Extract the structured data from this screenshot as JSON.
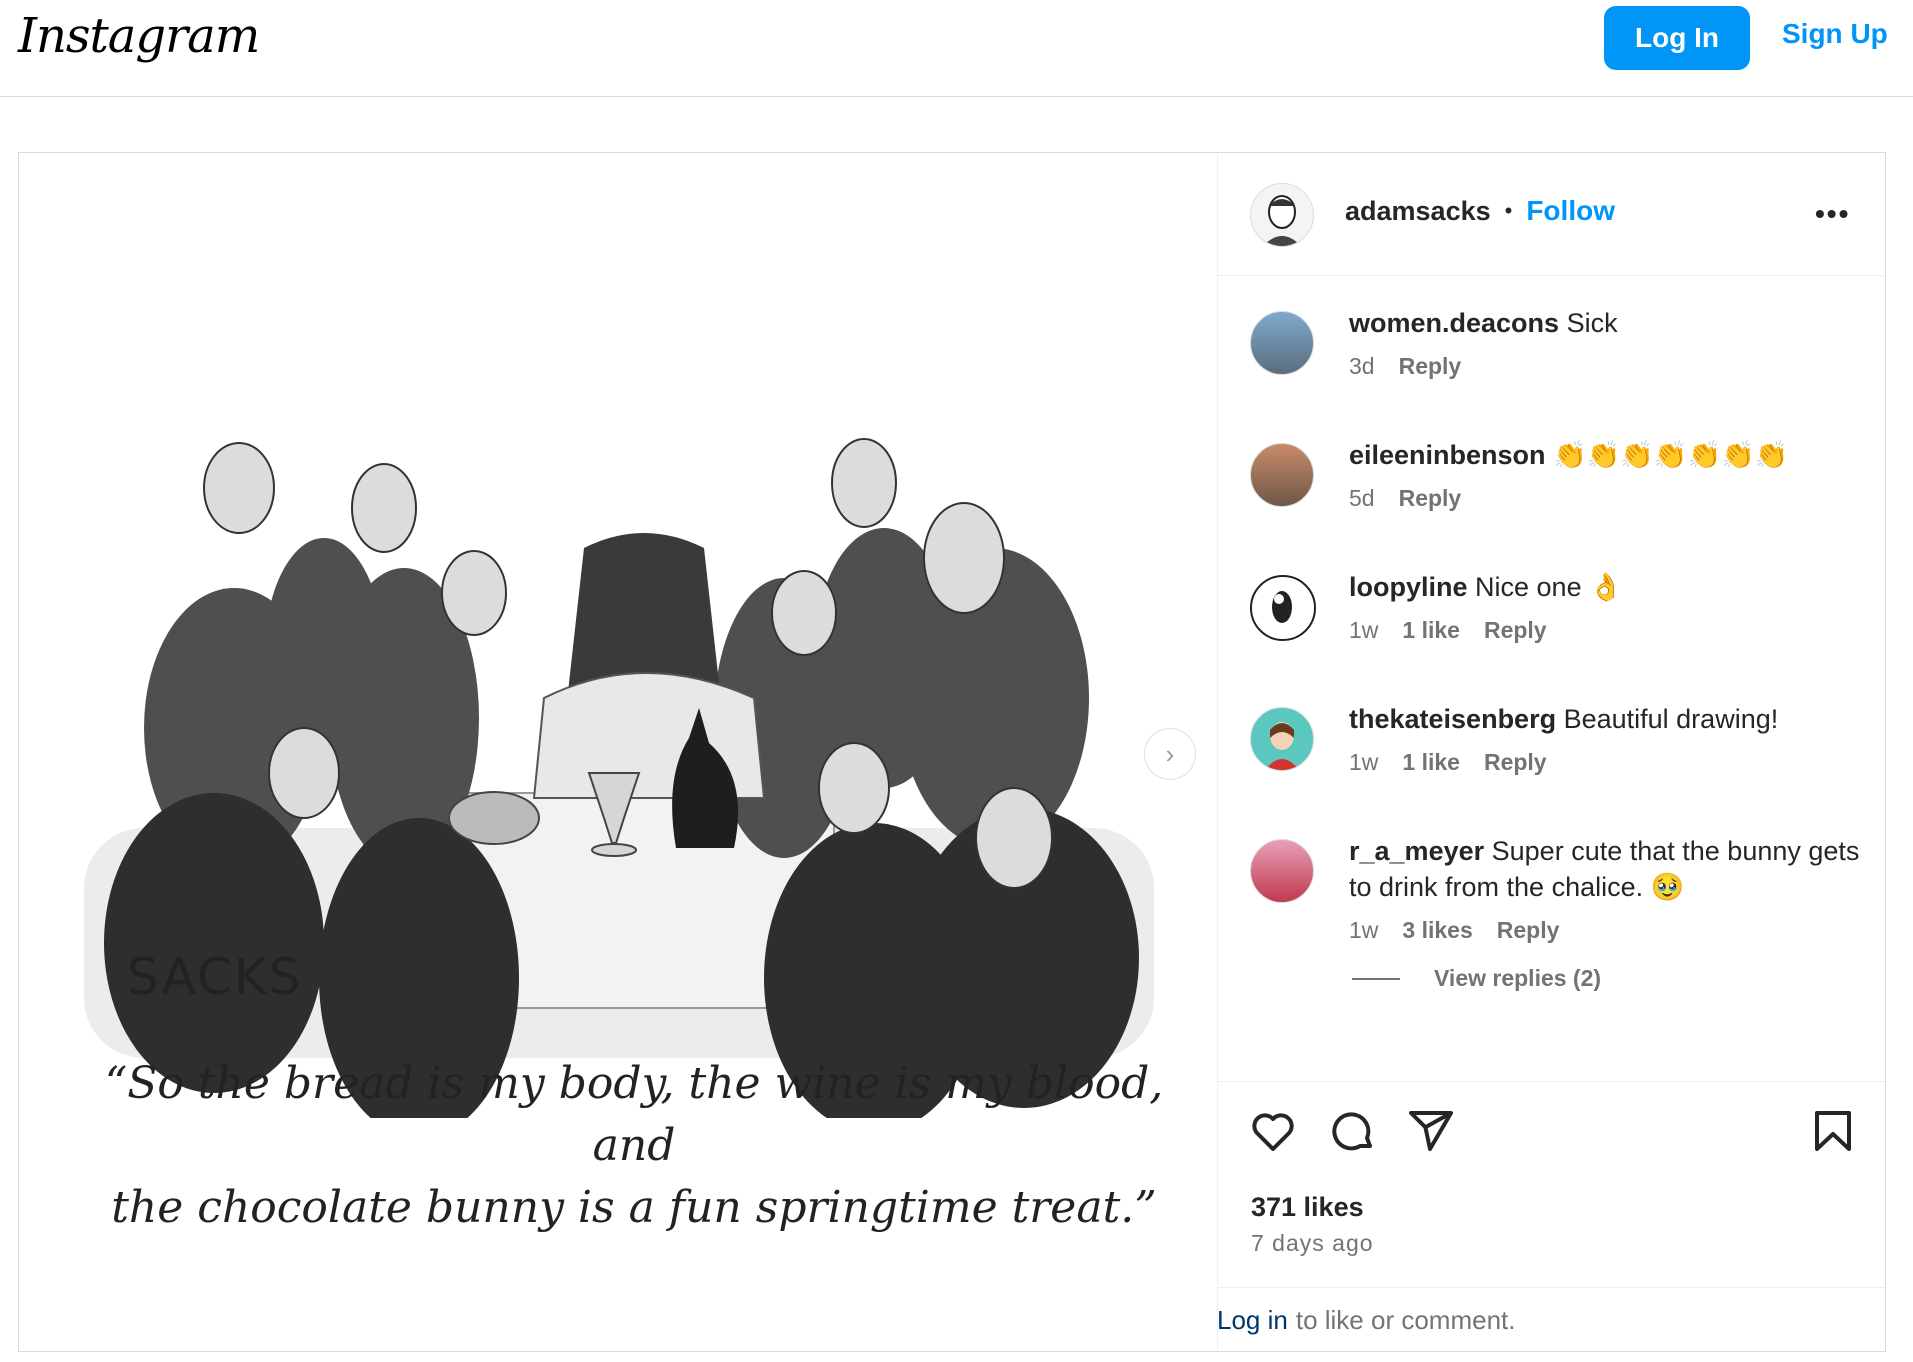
{
  "topbar": {
    "logo": "Instagram",
    "login_label": "Log In",
    "signup_label": "Sign Up"
  },
  "post": {
    "image": {
      "signature": "SACKS",
      "caption_line1": "“So the bread is my body, the wine is my blood, and",
      "caption_line2": "the chocolate bunny is a fun springtime treat.”",
      "next_icon": "chevron-right-icon"
    },
    "author": {
      "username": "adamsacks",
      "separator": "•",
      "follow_label": "Follow",
      "more_icon": "more-icon"
    },
    "comments": [
      {
        "username": "women.deacons",
        "text": "Sick",
        "time": "3d",
        "likes": "",
        "reply": "Reply"
      },
      {
        "username": "eileeninbenson",
        "text": "👏👏👏👏👏👏👏",
        "time": "5d",
        "likes": "",
        "reply": "Reply"
      },
      {
        "username": "loopyline",
        "text": "Nice one 👌",
        "time": "1w",
        "likes": "1 like",
        "reply": "Reply"
      },
      {
        "username": "thekateisenberg",
        "text": "Beautiful drawing!",
        "time": "1w",
        "likes": "1 like",
        "reply": "Reply"
      },
      {
        "username": "r_a_meyer",
        "text": "Super cute that the bunny gets to drink from the chalice. 🥹",
        "time": "1w",
        "likes": "3 likes",
        "reply": "Reply"
      }
    ],
    "view_replies": "View replies (2)",
    "likes": "371 likes",
    "posted": "7 days ago",
    "login_prompt": {
      "link": "Log in",
      "rest": "to like or comment."
    },
    "icons": [
      "heart-icon",
      "comment-icon",
      "share-icon",
      "bookmark-icon"
    ]
  }
}
